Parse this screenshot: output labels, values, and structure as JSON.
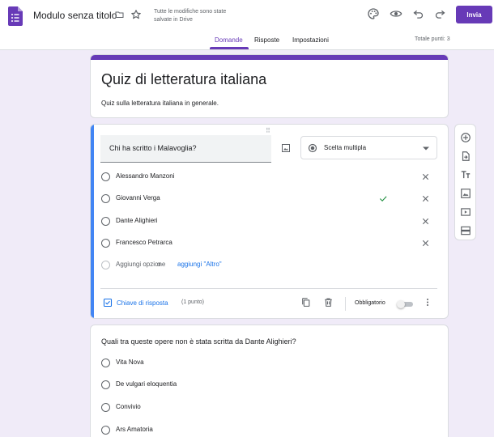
{
  "header": {
    "doc_title": "Modulo senza titolo",
    "save_status": "Tutte le modifiche sono state salvate in Drive",
    "send_label": "Invia",
    "icons": [
      "palette-icon",
      "preview-eye-icon",
      "undo-icon",
      "redo-icon"
    ],
    "accent_color": "#673ab7"
  },
  "tabs": [
    {
      "label": "Domande",
      "active": true
    },
    {
      "label": "Risposte",
      "active": false
    },
    {
      "label": "Impostazioni",
      "active": false
    }
  ],
  "total_points": "Totale punti: 3",
  "form": {
    "title": "Quiz di letteratura italiana",
    "description": "Quiz sulla letteratura italiana in generale."
  },
  "question1": {
    "text": "Chi ha scritto i Malavoglia?",
    "type": "Scelta multipla",
    "options": [
      {
        "label": "Alessandro Manzoni",
        "correct": false
      },
      {
        "label": "Giovanni Verga",
        "correct": true
      },
      {
        "label": "Dante Alighieri",
        "correct": false
      },
      {
        "label": "Francesco Petrarca",
        "correct": false
      }
    ],
    "add_option": "Aggiungi opzione",
    "or": "o",
    "add_other": "aggiungi \"Altro\"",
    "answer_key": "Chiave di risposta",
    "points": "(1 punto)",
    "required_label": "Obbligatorio",
    "required": false
  },
  "side_toolbar": [
    "add-question-icon",
    "import-questions-icon",
    "add-title-icon",
    "add-image-icon",
    "add-video-icon",
    "add-section-icon"
  ],
  "question2": {
    "text": "Quali tra queste opere non è stata scritta da Dante Alighieri?",
    "options": [
      "Vita Nova",
      "De vulgari eloquentia",
      "Convivio",
      "Ars Amatoria"
    ]
  }
}
